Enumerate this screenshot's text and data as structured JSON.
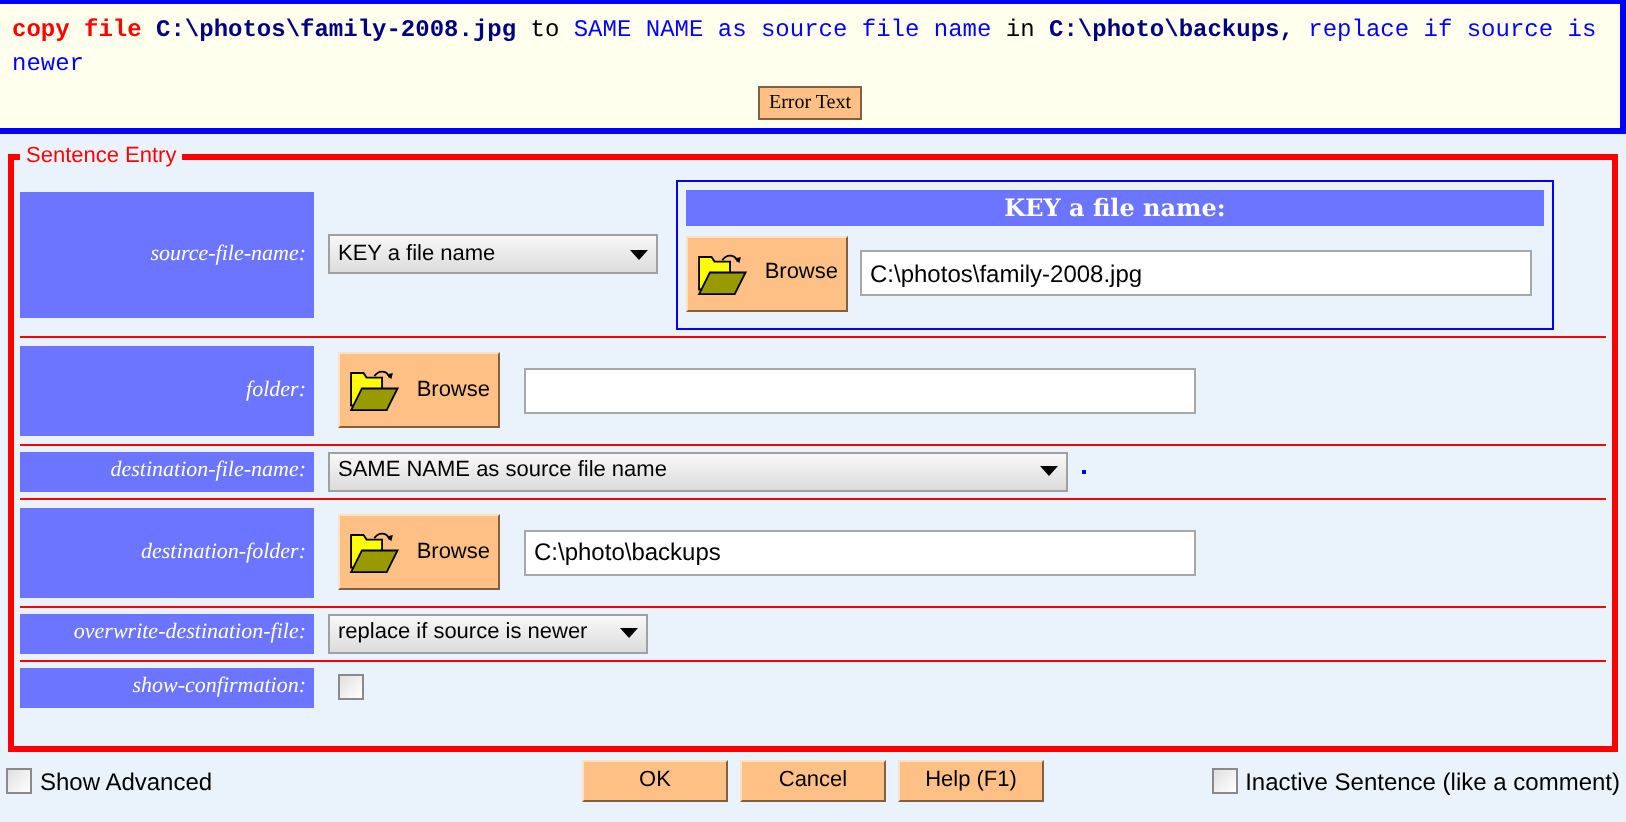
{
  "sentence": [
    {
      "kind": "keyword",
      "text": "copy file"
    },
    {
      "kind": "value",
      "text": "C:\\photos\\family-2008.jpg"
    },
    {
      "kind": "plain",
      "text": "to"
    },
    {
      "kind": "option",
      "text": "SAME NAME as source file name"
    },
    {
      "kind": "plain",
      "text": "in"
    },
    {
      "kind": "value",
      "text": "C:\\photo\\backups,"
    },
    {
      "kind": "option",
      "text": "replace if source is newer"
    }
  ],
  "error_button": "Error Text",
  "section_title": "Sentence Entry",
  "rows": [
    {
      "kind": "select_panel",
      "label": "source-file-name:",
      "select": "KEY a file name",
      "panel_title": "KEY a file name:",
      "browse": "Browse",
      "value": "C:\\photos\\family-2008.jpg"
    },
    {
      "kind": "browse",
      "label": "folder:",
      "browse": "Browse",
      "value": ""
    },
    {
      "kind": "select",
      "label": "destination-file-name:",
      "select": "SAME NAME as source file name",
      "wide": true
    },
    {
      "kind": "browse",
      "label": "destination-folder:",
      "browse": "Browse",
      "value": "C:\\photo\\backups"
    },
    {
      "kind": "select",
      "label": "overwrite-destination-file:",
      "select": "replace if source is newer",
      "wide": false
    },
    {
      "kind": "checkbox",
      "label": "show-confirmation:",
      "checked": false
    }
  ],
  "show_advanced": {
    "label": "Show Advanced",
    "checked": false
  },
  "buttons": [
    "OK",
    "Cancel",
    "Help (F1)"
  ],
  "inactive": {
    "label": "Inactive Sentence (like a comment)",
    "checked": false
  }
}
